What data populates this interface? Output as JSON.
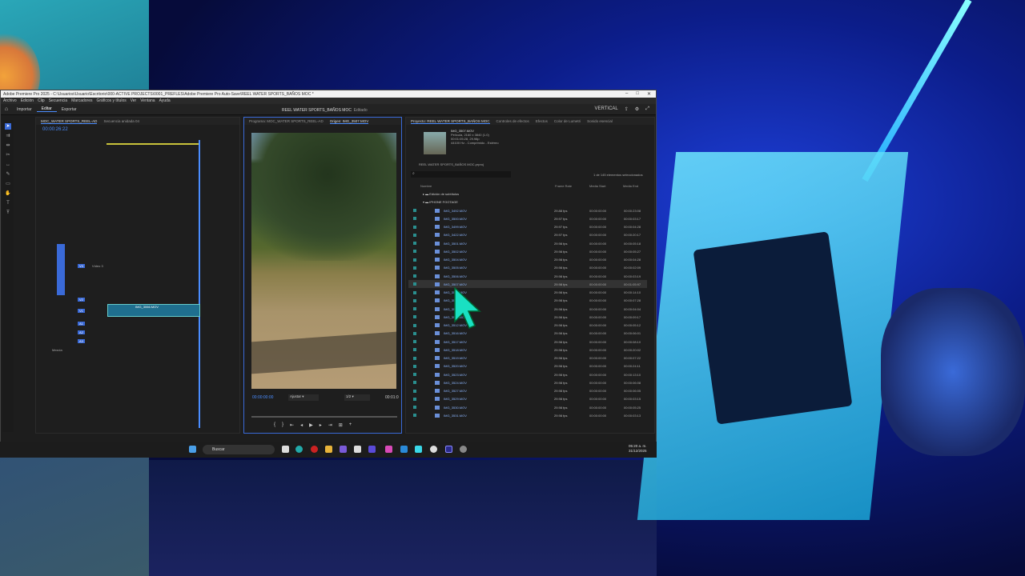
{
  "titlebar": {
    "title": "Adobe Premiere Pro 2025 - C:\\Usuarios\\Usuario\\Escritorio\\000-ACTIVE PROJECTS\\0001_PREFLES\\Adobe Premiere Pro Auto-Save\\REEL WATER SPORTS_BAÑOS MOC *"
  },
  "menubar": [
    "Archivo",
    "Edición",
    "Clip",
    "Secuencia",
    "Marcadores",
    "Gráficos y títulos",
    "Ver",
    "Ventana",
    "Ayuda"
  ],
  "workspace": {
    "tabs": [
      "Importar",
      "Editar",
      "Exportar"
    ],
    "active": "Editar",
    "project_title": "REEL WATER SPORTS_BAÑOS MOC",
    "status": "Editado",
    "layout": "VERTICAL"
  },
  "timeline": {
    "tabs": [
      "MOC_WATER SPORTS_REEL-AD",
      "Secuencia anidada 04"
    ],
    "timecode": "00:00:26:22",
    "video_tracks": [
      {
        "name": "V3",
        "label": "Vídeo 3"
      },
      {
        "name": "V2"
      },
      {
        "name": "V1"
      }
    ],
    "audio_tracks": [
      "A1",
      "A2",
      "A3"
    ],
    "mix_label": "Mezcla",
    "clip_label": "IMG_3066.MOV"
  },
  "program_monitor": {
    "tabs": [
      "Programa: MOC_WATER SPORTS_REEL-AD",
      "Origen: IMG_3507.MOV"
    ],
    "timecode": "00:00:00:00",
    "fit": "Ajustar",
    "quality": "1/2",
    "duration": "00:01:0"
  },
  "project_panel": {
    "tabs": [
      "Proyecto: REEL WATER SPORTS_BAÑOS MOC",
      "Controles de efectos",
      "Efectos",
      "Color de Lumetri",
      "Sonido esencial"
    ],
    "clip_info": {
      "name": "IMG_3507.MOV",
      "line1": "Película, 2160 x 3840 (1.0)",
      "line2": "00:01:05:28, 29.98p",
      "line3": "44100 Hz - Comprimido - Estéreo"
    },
    "project_file": "REEL WATER SPORTS_BAÑOS MOC.prproj",
    "selection_count": "1 de 145 elementos seleccionados",
    "columns": [
      "Nombre",
      "Frame Rate",
      "Media Start",
      "Media End"
    ],
    "folders": [
      "Edición de subtítulos",
      "IPHONE FOOTAGE"
    ],
    "files": [
      {
        "name": "IMG_3492.MOV",
        "fps": "29.88 fps",
        "start": "00:00:00:00",
        "end": "00:00:23:08"
      },
      {
        "name": "IMG_3500.MOV",
        "fps": "29.97 fps",
        "start": "00:00:00:00",
        "end": "00:00:03:17"
      },
      {
        "name": "IMG_3499.MOV",
        "fps": "29.97 fps",
        "start": "00:00:00:00",
        "end": "00:00:04:28"
      },
      {
        "name": "IMG_3422.MOV",
        "fps": "29.97 fps",
        "start": "00:00:00:00",
        "end": "00:00:20:17"
      },
      {
        "name": "IMG_3501.MOV",
        "fps": "29.98 fps",
        "start": "00:00:00:00",
        "end": "00:00:05:18"
      },
      {
        "name": "IMG_3502.MOV",
        "fps": "29.98 fps",
        "start": "00:00:00:00",
        "end": "00:00:05:27"
      },
      {
        "name": "IMG_3504.MOV",
        "fps": "29.98 fps",
        "start": "00:00:00:00",
        "end": "00:00:04:28"
      },
      {
        "name": "IMG_3505.MOV",
        "fps": "29.98 fps",
        "start": "00:00:00:00",
        "end": "00:00:02:09"
      },
      {
        "name": "IMG_3506.MOV",
        "fps": "29.98 fps",
        "start": "00:00:00:00",
        "end": "00:00:03:19"
      },
      {
        "name": "IMG_3507.MOV",
        "fps": "29.98 fps",
        "start": "00:00:00:00",
        "end": "00:01:05:97"
      },
      {
        "name": "IMG_3508.MOV",
        "fps": "29.98 fps",
        "start": "00:00:00:00",
        "end": "00:00:14:10"
      },
      {
        "name": "IMG_3509.MOV",
        "fps": "29.98 fps",
        "start": "00:00:00:00",
        "end": "00:00:07:28"
      },
      {
        "name": "IMG_3510.MOV",
        "fps": "29.98 fps",
        "start": "00:00:00:00",
        "end": "00:00:04:04"
      },
      {
        "name": "IMG_3511.MOV",
        "fps": "29.98 fps",
        "start": "00:00:00:00",
        "end": "00:00:09:17"
      },
      {
        "name": "IMG_3512.MOV",
        "fps": "29.98 fps",
        "start": "00:00:00:00",
        "end": "00:00:05:12"
      },
      {
        "name": "IMG_3516.MOV",
        "fps": "29.98 fps",
        "start": "00:00:00:00",
        "end": "00:00:06:01"
      },
      {
        "name": "IMG_3517.MOV",
        "fps": "29.98 fps",
        "start": "00:00:00:00",
        "end": "00:00:08:10"
      },
      {
        "name": "IMG_3518.MOV",
        "fps": "29.98 fps",
        "start": "00:00:00:00",
        "end": "00:00:20:02"
      },
      {
        "name": "IMG_3519.MOV",
        "fps": "29.98 fps",
        "start": "00:00:00:00",
        "end": "00:00:07:22"
      },
      {
        "name": "IMG_3520.MOV",
        "fps": "29.98 fps",
        "start": "00:00:00:00",
        "end": "00:00:24:11"
      },
      {
        "name": "IMG_3523.MOV",
        "fps": "29.98 fps",
        "start": "00:00:00:00",
        "end": "00:00:13:10"
      },
      {
        "name": "IMG_3524.MOV",
        "fps": "29.98 fps",
        "start": "00:00:00:00",
        "end": "00:00:06:08"
      },
      {
        "name": "IMG_3527.MOV",
        "fps": "29.98 fps",
        "start": "00:00:00:00",
        "end": "00:00:06:05"
      },
      {
        "name": "IMG_3529.MOV",
        "fps": "29.98 fps",
        "start": "00:00:00:00",
        "end": "00:00:03:15"
      },
      {
        "name": "IMG_3530.MOV",
        "fps": "29.98 fps",
        "start": "00:00:00:00",
        "end": "00:00:05:25"
      },
      {
        "name": "IMG_3531.MOV",
        "fps": "29.98 fps",
        "start": "00:00:00:00",
        "end": "00:00:03:13"
      }
    ]
  },
  "taskbar": {
    "search": "Buscar",
    "time": "05:20 a. m.",
    "date": "31/12/2025"
  },
  "colors": {
    "accent": "#4a8dff",
    "clip": "#1f6f8f",
    "cursor": "#19e0c2"
  }
}
